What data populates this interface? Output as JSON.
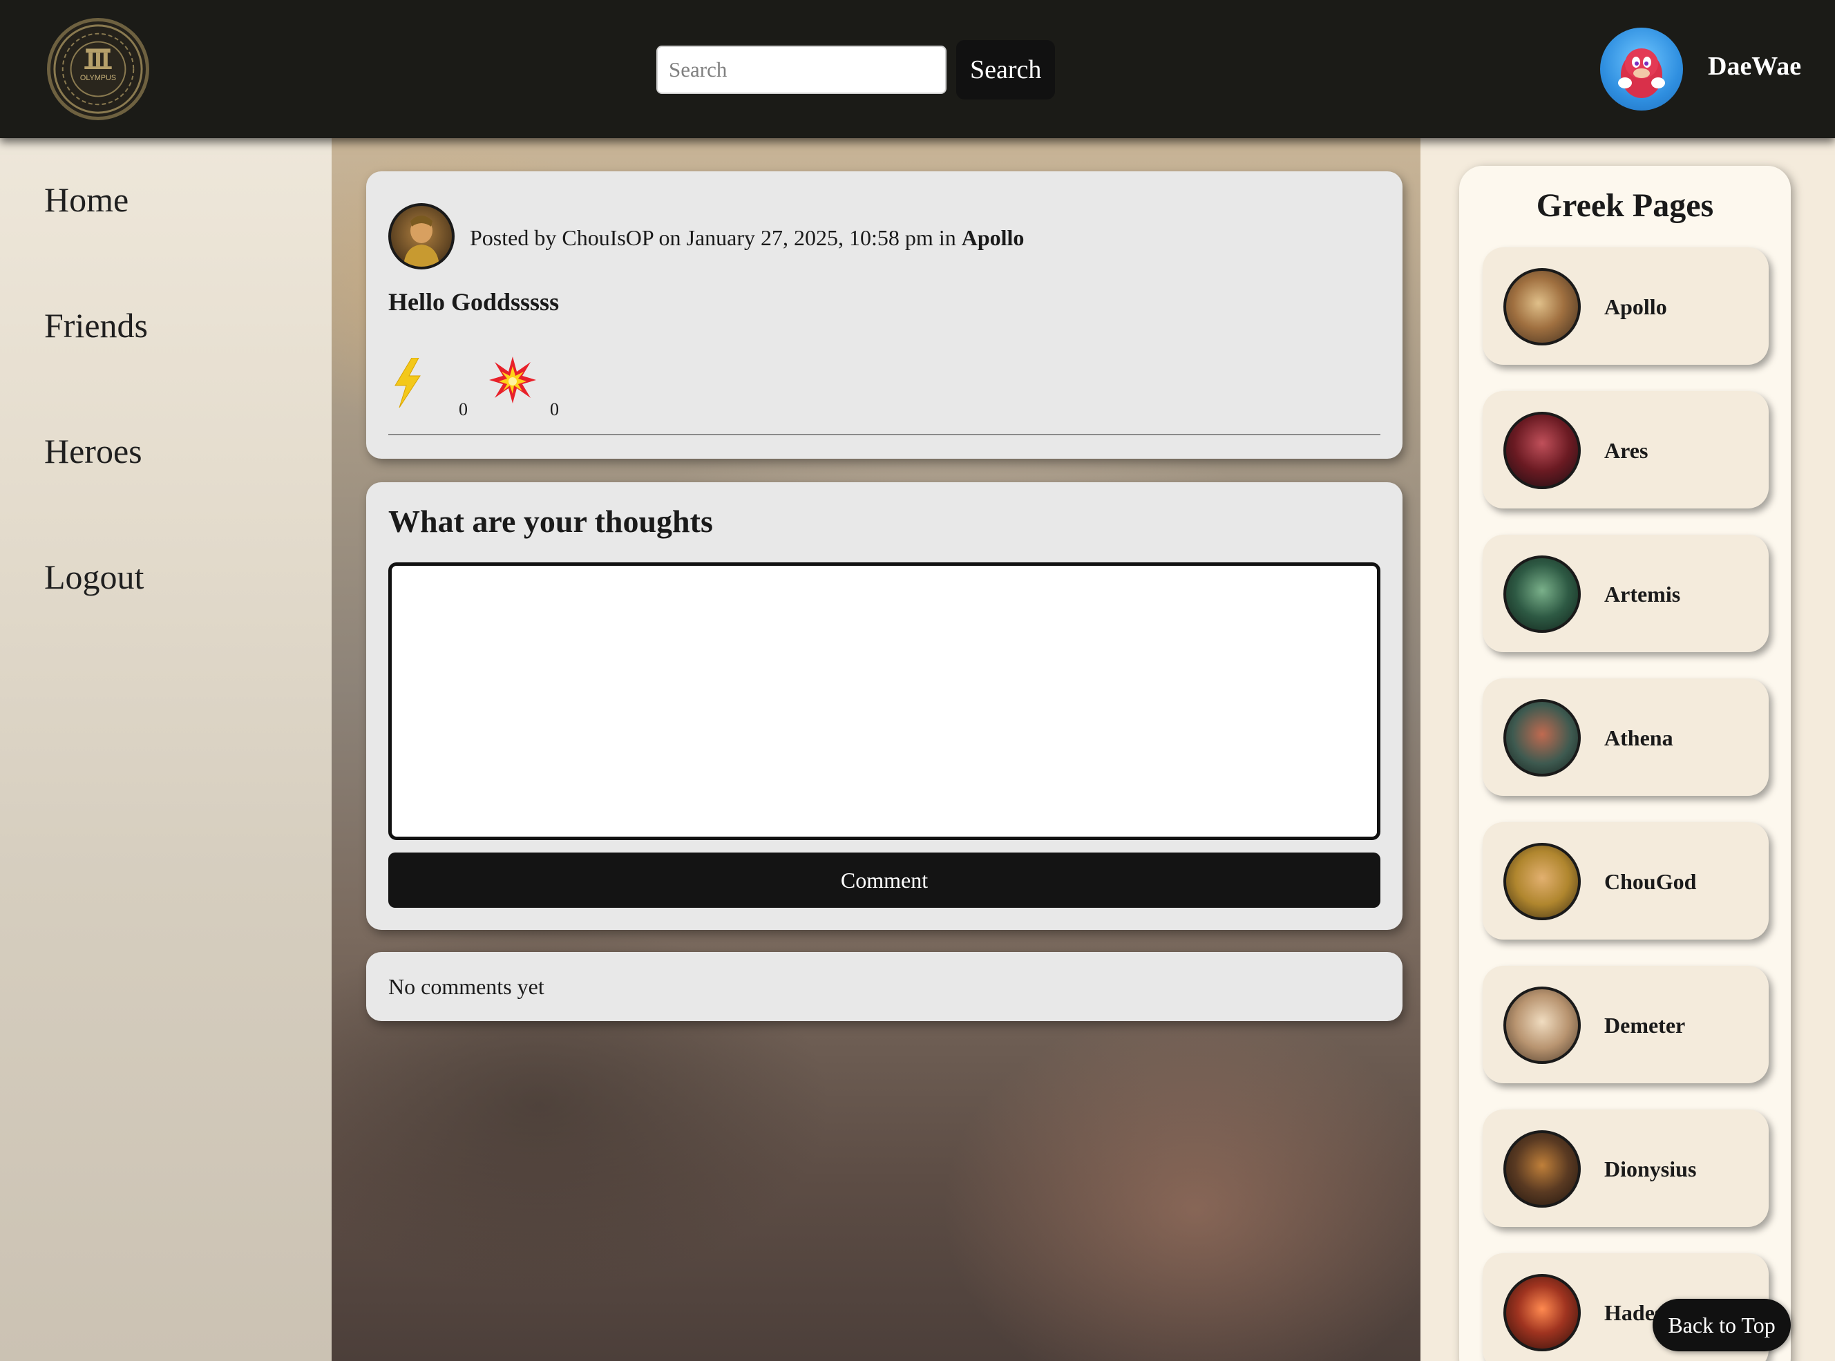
{
  "header": {
    "logo_text": "OLYMPUS",
    "search": {
      "placeholder": "Search",
      "value": "",
      "button_label": "Search"
    },
    "user": {
      "name": "DaeWae"
    }
  },
  "sidebar": {
    "items": [
      {
        "label": "Home"
      },
      {
        "label": "Friends"
      },
      {
        "label": "Heroes"
      },
      {
        "label": "Logout"
      }
    ]
  },
  "post": {
    "meta_prefix": "Posted by ChouIsOP on January 27, 2025, 10:58 pm in ",
    "page_name": "Apollo",
    "title": "Hello Goddsssss",
    "reactions": [
      {
        "icon": "lightning-icon",
        "count": "0"
      },
      {
        "icon": "explosion-icon",
        "count": "0"
      }
    ]
  },
  "comment_form": {
    "title": "What are your thoughts",
    "value": "",
    "button_label": "Comment"
  },
  "comments": {
    "empty_text": "No comments yet"
  },
  "greek_pages": {
    "title": "Greek Pages",
    "items": [
      {
        "name": "Apollo"
      },
      {
        "name": "Ares"
      },
      {
        "name": "Artemis"
      },
      {
        "name": "Athena"
      },
      {
        "name": "ChouGod"
      },
      {
        "name": "Demeter"
      },
      {
        "name": "Dionysius"
      },
      {
        "name": "Hades"
      }
    ]
  },
  "back_to_top_label": "Back to Top",
  "colors": {
    "header_bg": "#1b1b17",
    "card_bg": "#e8e8e8",
    "panel_bg": "#fdf8ee",
    "god_card_bg": "#f4ebdc",
    "button_bg": "#141414"
  }
}
